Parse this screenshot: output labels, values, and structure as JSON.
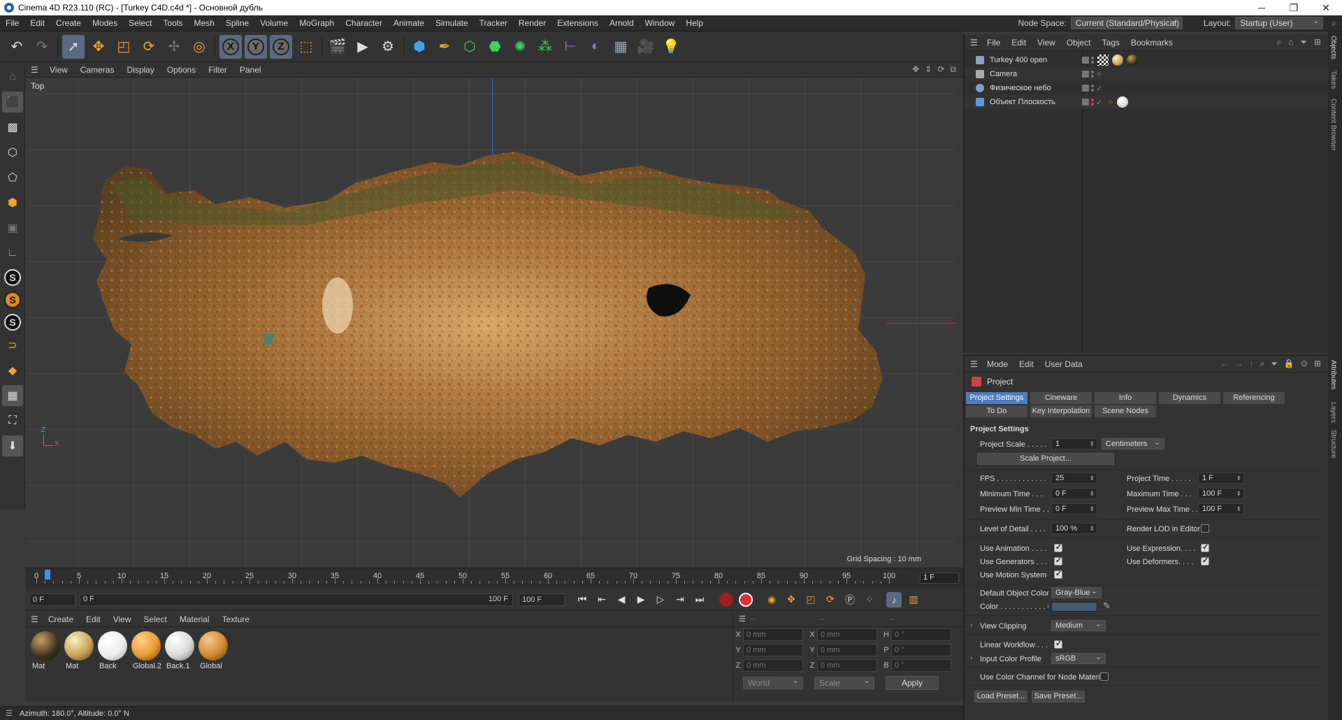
{
  "window": {
    "title": "Cinema 4D R23.110 (RC) - [Turkey C4D.c4d *] - Основной дубль",
    "minimize": "─",
    "maximize": "❐",
    "close": "✕"
  },
  "menu": [
    "File",
    "Edit",
    "Create",
    "Modes",
    "Select",
    "Tools",
    "Mesh",
    "Spline",
    "Volume",
    "MoGraph",
    "Character",
    "Animate",
    "Simulate",
    "Tracker",
    "Render",
    "Extensions",
    "Arnold",
    "Window",
    "Help"
  ],
  "nodespace": {
    "label": "Node Space:",
    "value": "Current (Standard/Physical)"
  },
  "layout": {
    "label": "Layout:",
    "value": "Startup (User)"
  },
  "viewport": {
    "menu": [
      "View",
      "Cameras",
      "Display",
      "Options",
      "Filter",
      "Panel"
    ],
    "label": "Top",
    "grid_spacing": "Grid Spacing : 10 mm",
    "axis_z": "Z",
    "axis_x": "X"
  },
  "timeline": {
    "ticks": [
      "0",
      "5",
      "10",
      "15",
      "20",
      "25",
      "30",
      "35",
      "40",
      "45",
      "50",
      "55",
      "60",
      "65",
      "70",
      "75",
      "80",
      "85",
      "90",
      "95",
      "100"
    ],
    "current": "1 F"
  },
  "transport": {
    "start": "0 F",
    "range_start": "0 F",
    "range_end": "100 F",
    "end": "100 F"
  },
  "materials": {
    "menu": [
      "Create",
      "Edit",
      "View",
      "Select",
      "Material",
      "Texture"
    ],
    "items": [
      {
        "name": "Mat",
        "color": "#3a3020"
      },
      {
        "name": "Mat",
        "color": "#c9a35a"
      },
      {
        "name": "Back",
        "color": "#eeeeee"
      },
      {
        "name": "Global.2",
        "color": "#e89a30"
      },
      {
        "name": "Back.1",
        "color": "#d8d8d8"
      },
      {
        "name": "Global",
        "color": "#d08a35"
      }
    ]
  },
  "coords": {
    "headers": [
      "--",
      "--",
      "--"
    ],
    "rows": [
      {
        "a": "X",
        "av": "0 mm",
        "b": "X",
        "bv": "0 mm",
        "c": "H",
        "cv": "0 °"
      },
      {
        "a": "Y",
        "av": "0 mm",
        "b": "Y",
        "bv": "0 mm",
        "c": "P",
        "cv": "0 °"
      },
      {
        "a": "Z",
        "av": "0 mm",
        "b": "Z",
        "bv": "0 mm",
        "c": "B",
        "cv": "0 °"
      }
    ],
    "world": "World",
    "scale": "Scale",
    "apply": "Apply"
  },
  "status": "Azimuth: 180.0°, Altitude: 0.0°  N",
  "objects": {
    "menu": [
      "File",
      "Edit",
      "View",
      "Object",
      "Tags",
      "Bookmarks"
    ],
    "items": [
      {
        "name": "Turkey 400 open",
        "color": "#8aa0c0"
      },
      {
        "name": "Camera",
        "color": "#aaaaaa"
      },
      {
        "name": "Физическое небо",
        "color": "#7aa0d0"
      },
      {
        "name": "Объект Плоскость",
        "color": "#5a9ae0"
      }
    ]
  },
  "side_tabs": [
    "Objects",
    "Takes",
    "Content Browser",
    "Attributes",
    "Layers",
    "Structure"
  ],
  "attributes": {
    "menu": [
      "Mode",
      "Edit",
      "User Data"
    ],
    "title": "Project",
    "tabs": [
      "Project Settings",
      "Cineware",
      "Info",
      "Dynamics",
      "Referencing"
    ],
    "tabs2": [
      "To Do",
      "Key Interpolation",
      "Scene Nodes"
    ],
    "section": "Project Settings",
    "project_scale": {
      "label": "Project Scale . . . . .",
      "value": "1",
      "unit": "Centimeters"
    },
    "scale_button": "Scale Project...",
    "fps": {
      "label": "FPS . . . . . . . . . . . .",
      "value": "25"
    },
    "project_time": {
      "label": "Project Time . . . . .",
      "value": "1 F"
    },
    "min_time": {
      "label": "Minimum Time . . .",
      "value": "0 F"
    },
    "max_time": {
      "label": "Maximum Time . . .",
      "value": "100 F"
    },
    "prev_min": {
      "label": "Preview Min Time . .",
      "value": "0 F"
    },
    "prev_max": {
      "label": "Preview Max Time . .",
      "value": "100 F"
    },
    "lod": {
      "label": "Level of Detail . . . .",
      "value": "100 %"
    },
    "render_lod": "Render LOD in Editor",
    "use_animation": "Use Animation . . . .",
    "use_expression": "Use Expression. . . .",
    "use_generators": "Use Generators . . .",
    "use_deformers": "Use Deformers. . . .",
    "use_motion": "Use Motion System",
    "default_color": {
      "label": "Default Object Color",
      "value": "Gray-Blue"
    },
    "color_label": "Color . . . . . . . . . . .",
    "view_clipping": {
      "label": "View Clipping",
      "value": "Medium"
    },
    "linear_workflow": "Linear Workflow . . .",
    "input_profile": {
      "label": "Input Color Profile",
      "value": "sRGB"
    },
    "color_channel": "Use Color Channel for Node Material",
    "load_preset": "Load Preset...",
    "save_preset": "Save Preset..."
  }
}
